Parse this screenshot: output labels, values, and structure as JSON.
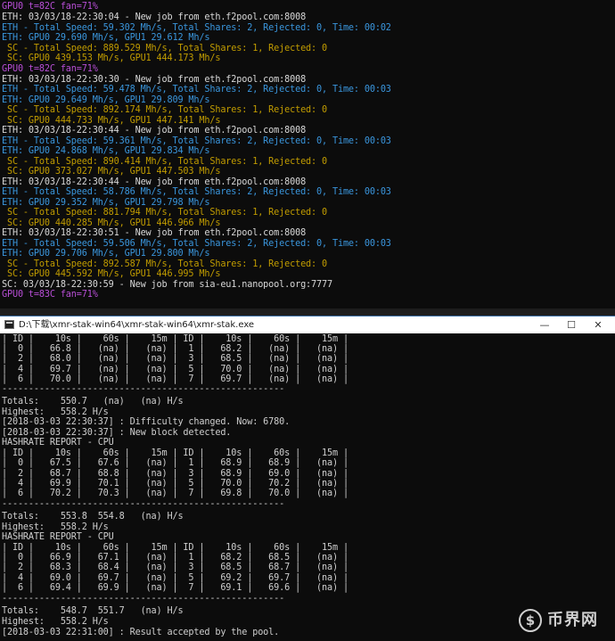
{
  "terminal1": {
    "lines": [
      {
        "text": "GPU0 t=82C fan=71%",
        "color": "magenta"
      },
      {
        "text": "ETH: 03/03/18-22:30:04 - New job from eth.f2pool.com:8008",
        "color": "white"
      },
      {
        "text": "ETH - Total Speed: 59.302 Mh/s, Total Shares: 2, Rejected: 0, Time: 00:02",
        "color": "cyan"
      },
      {
        "text": "ETH: GPU0 29.690 Mh/s, GPU1 29.612 Mh/s",
        "color": "cyan"
      },
      {
        "text": " SC - Total Speed: 889.529 Mh/s, Total Shares: 1, Rejected: 0",
        "color": "yellow"
      },
      {
        "text": " SC: GPU0 439.153 Mh/s, GPU1 444.173 Mh/s",
        "color": "yellow"
      },
      {
        "text": "GPU0 t=82C fan=71%",
        "color": "magenta"
      },
      {
        "text": "ETH: 03/03/18-22:30:30 - New job from eth.f2pool.com:8008",
        "color": "white"
      },
      {
        "text": "ETH - Total Speed: 59.478 Mh/s, Total Shares: 2, Rejected: 0, Time: 00:03",
        "color": "cyan"
      },
      {
        "text": "ETH: GPU0 29.649 Mh/s, GPU1 29.809 Mh/s",
        "color": "cyan"
      },
      {
        "text": " SC - Total Speed: 892.174 Mh/s, Total Shares: 1, Rejected: 0",
        "color": "yellow"
      },
      {
        "text": " SC: GPU0 444.733 Mh/s, GPU1 447.141 Mh/s",
        "color": "yellow"
      },
      {
        "text": "ETH: 03/03/18-22:30:44 - New job from eth.f2pool.com:8008",
        "color": "white"
      },
      {
        "text": "ETH - Total Speed: 59.361 Mh/s, Total Shares: 2, Rejected: 0, Time: 00:03",
        "color": "cyan"
      },
      {
        "text": "ETH: GPU0 24.868 Mh/s, GPU1 29.834 Mh/s",
        "color": "cyan"
      },
      {
        "text": " SC - Total Speed: 890.414 Mh/s, Total Shares: 1, Rejected: 0",
        "color": "yellow"
      },
      {
        "text": " SC: GPU0 373.027 Mh/s, GPU1 447.503 Mh/s",
        "color": "yellow"
      },
      {
        "text": "ETH: 03/03/18-22:30:44 - New job from eth.f2pool.com:8008",
        "color": "white"
      },
      {
        "text": "ETH - Total Speed: 58.786 Mh/s, Total Shares: 2, Rejected: 0, Time: 00:03",
        "color": "cyan"
      },
      {
        "text": "ETH: GPU0 29.352 Mh/s, GPU1 29.798 Mh/s",
        "color": "cyan"
      },
      {
        "text": " SC - Total Speed: 881.794 Mh/s, Total Shares: 1, Rejected: 0",
        "color": "yellow"
      },
      {
        "text": " SC: GPU0 440.285 Mh/s, GPU1 446.966 Mh/s",
        "color": "yellow"
      },
      {
        "text": "ETH: 03/03/18-22:30:51 - New job from eth.f2pool.com:8008",
        "color": "white"
      },
      {
        "text": "ETH - Total Speed: 59.506 Mh/s, Total Shares: 2, Rejected: 0, Time: 00:03",
        "color": "cyan"
      },
      {
        "text": "ETH: GPU0 29.706 Mh/s, GPU1 29.800 Mh/s",
        "color": "cyan"
      },
      {
        "text": " SC - Total Speed: 892.587 Mh/s, Total Shares: 1, Rejected: 0",
        "color": "yellow"
      },
      {
        "text": " SC: GPU0 445.592 Mh/s, GPU1 446.995 Mh/s",
        "color": "yellow"
      },
      {
        "text": "SC: 03/03/18-22:30:59 - New job from sia-eu1.nanopool.org:7777",
        "color": "white"
      },
      {
        "text": "GPU0 t=83C fan=71%",
        "color": "magenta"
      }
    ]
  },
  "window2": {
    "title": "D:\\下载\\xmr-stak-win64\\xmr-stak-win64\\xmr-stak.exe",
    "minimize_glyph": "—",
    "maximize_glyph": "☐",
    "close_glyph": "✕",
    "lines": [
      "| ID |    10s |    60s |    15m | ID |    10s |    60s |    15m |",
      "|  0 |   66.8 |   (na) |   (na) |  1 |   68.2 |   (na) |   (na) |",
      "|  2 |   68.0 |   (na) |   (na) |  3 |   68.5 |   (na) |   (na) |",
      "|  4 |   69.7 |   (na) |   (na) |  5 |   70.0 |   (na) |   (na) |",
      "|  6 |   70.0 |   (na) |   (na) |  7 |   69.7 |   (na) |   (na) |",
      "-----------------------------------------------------",
      "Totals:    550.7   (na)   (na) H/s",
      "Highest:   558.2 H/s",
      "[2018-03-03 22:30:37] : Difficulty changed. Now: 6780.",
      "[2018-03-03 22:30:37] : New block detected.",
      "HASHRATE REPORT - CPU",
      "| ID |    10s |    60s |    15m | ID |    10s |    60s |    15m |",
      "|  0 |   67.5 |   67.6 |   (na) |  1 |   68.9 |   68.9 |   (na) |",
      "|  2 |   68.7 |   68.8 |   (na) |  3 |   68.9 |   69.0 |   (na) |",
      "|  4 |   69.9 |   70.1 |   (na) |  5 |   70.0 |   70.2 |   (na) |",
      "|  6 |   70.2 |   70.3 |   (na) |  7 |   69.8 |   70.0 |   (na) |",
      "-----------------------------------------------------",
      "Totals:    553.8  554.8   (na) H/s",
      "Highest:   558.2 H/s",
      "HASHRATE REPORT - CPU",
      "| ID |    10s |    60s |    15m | ID |    10s |    60s |    15m |",
      "|  0 |   66.9 |   67.1 |   (na) |  1 |   68.2 |   68.5 |   (na) |",
      "|  2 |   68.3 |   68.4 |   (na) |  3 |   68.5 |   68.7 |   (na) |",
      "|  4 |   69.0 |   69.7 |   (na) |  5 |   69.2 |   69.7 |   (na) |",
      "|  6 |   69.4 |   69.9 |   (na) |  7 |   69.1 |   69.6 |   (na) |",
      "-----------------------------------------------------",
      "Totals:    548.7  551.7   (na) H/s",
      "Highest:   558.2 H/s",
      "[2018-03-03 22:31:00] : Result accepted by the pool."
    ]
  },
  "watermark": {
    "icon": "coin-logo-icon",
    "text": "币界网"
  },
  "colors": {
    "magenta": "#b84ed6",
    "white": "#d8d8d8",
    "cyan": "#3a96dd",
    "yellow": "#c19c00"
  }
}
